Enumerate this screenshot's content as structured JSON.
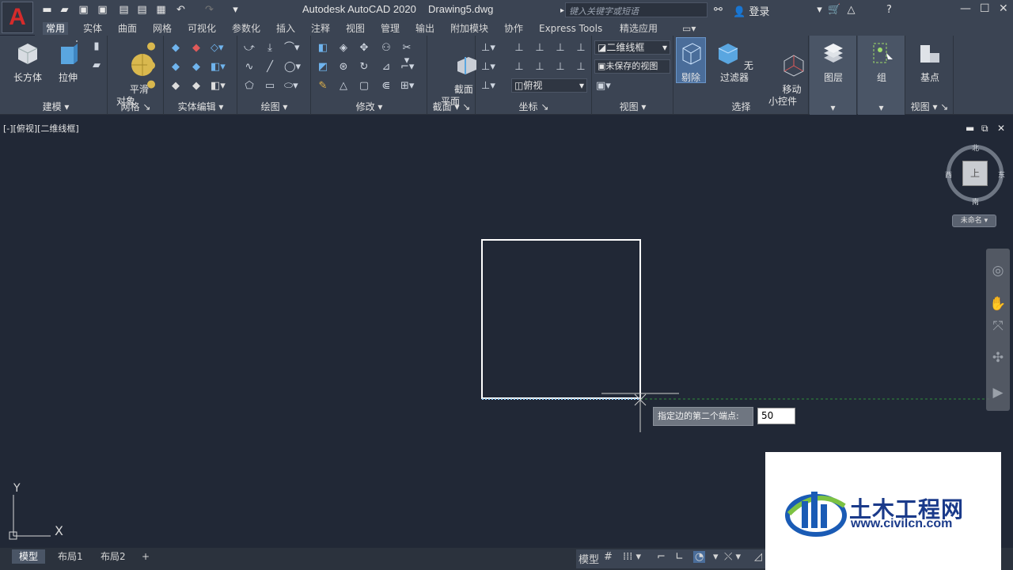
{
  "title": {
    "app": "Autodesk AutoCAD 2020",
    "document": "Drawing5.dwg",
    "search_placeholder": "键入关键字或短语",
    "login": "登录",
    "logo": "A"
  },
  "tabs": [
    "常用",
    "实体",
    "曲面",
    "网格",
    "可视化",
    "参数化",
    "插入",
    "注释",
    "视图",
    "管理",
    "输出",
    "附加模块",
    "协作",
    "Express Tools",
    "精选应用"
  ],
  "active_tab": "常用",
  "ribbon": {
    "modeling": {
      "label": "建模",
      "box": "长方体",
      "extrude": "拉伸"
    },
    "mesh": {
      "label": "网格",
      "smooth": "平滑\n对象"
    },
    "solid_edit": {
      "label": "实体编辑"
    },
    "draw": {
      "label": "绘图"
    },
    "modify": {
      "label": "修改"
    },
    "section": {
      "label": "截面",
      "section_plane": "截面\n平面"
    },
    "coords": {
      "label": "坐标",
      "view_combo": "俯视"
    },
    "view": {
      "label": "视图",
      "visual_style": "二维线框",
      "saved_view": "未保存的视图"
    },
    "selection": {
      "label": "选择",
      "cull": "剔除",
      "no_filter": "无过滤器",
      "gizmo": "移动\n小控件"
    },
    "layers": {
      "label": "图层"
    },
    "groups": {
      "label": "组"
    },
    "base": {
      "label": "视图",
      "base_point": "基点"
    }
  },
  "viewport": {
    "label": "[-][俯视][二维线框]",
    "compass": {
      "north": "北",
      "south": "南",
      "east": "东",
      "west": "西"
    },
    "cube_face": "上",
    "ucs_name": "未命名",
    "ucs_y": "Y",
    "ucs_x": "X"
  },
  "command_prompt": {
    "tooltip": "指定边的第二个端点:",
    "input_value": "50"
  },
  "layout_tabs": [
    "模型",
    "布局1",
    "布局2",
    "+"
  ],
  "status": {
    "model": "模型"
  },
  "watermark": {
    "cn": "土木工程网",
    "url": "www.civilcn.com"
  },
  "colors": {
    "bg": "#212836",
    "ribbon": "#3b4453",
    "accent": "#4a5566"
  }
}
